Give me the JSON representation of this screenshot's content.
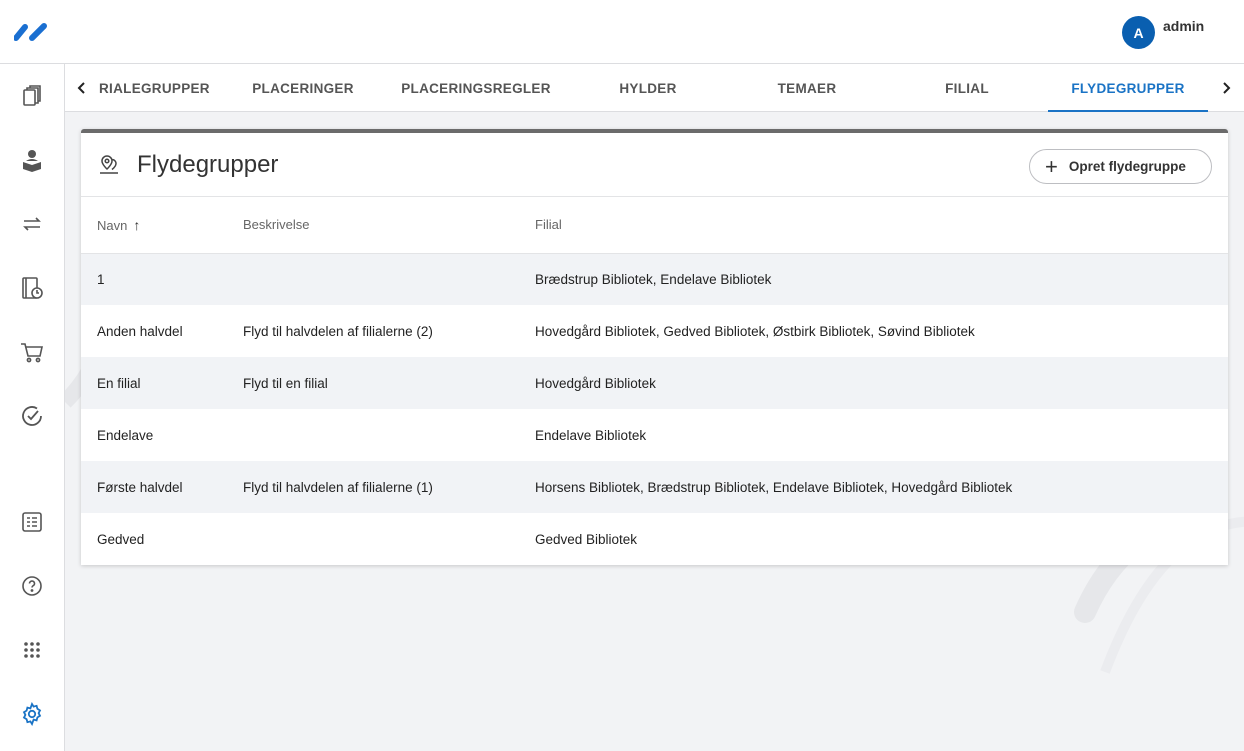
{
  "user": {
    "initial": "A",
    "name": "admin"
  },
  "tabs": [
    {
      "label": "RIALEGRUPPER",
      "active": false
    },
    {
      "label": "PLACERINGER",
      "active": false
    },
    {
      "label": "PLACERINGSREGLER",
      "active": false
    },
    {
      "label": "HYLDER",
      "active": false
    },
    {
      "label": "TEMAER",
      "active": false
    },
    {
      "label": "FILIAL",
      "active": false
    },
    {
      "label": "FLYDEGRUPPER",
      "active": true
    }
  ],
  "sidebar": {
    "icons": [
      "books-icon",
      "reader-icon",
      "transfer-icon",
      "book-clock-icon",
      "cart-icon",
      "check-circle-icon",
      "report-icon",
      "help-icon",
      "apps-grid-icon",
      "gear-icon"
    ]
  },
  "card": {
    "title": "Flydegrupper",
    "create_label": "Opret flydegruppe",
    "columns": {
      "name": "Navn",
      "description": "Beskrivelse",
      "branch": "Filial"
    },
    "rows": [
      {
        "name": "1",
        "description": "",
        "branch": "Brædstrup Bibliotek, Endelave Bibliotek"
      },
      {
        "name": "Anden halvdel",
        "description": "Flyd til halvdelen af filialerne (2)",
        "branch": "Hovedgård Bibliotek, Gedved Bibliotek, Østbirk Bibliotek, Søvind Bibliotek"
      },
      {
        "name": "En filial",
        "description": "Flyd til en filial",
        "branch": "Hovedgård Bibliotek"
      },
      {
        "name": "Endelave",
        "description": "",
        "branch": "Endelave Bibliotek"
      },
      {
        "name": "Første halvdel",
        "description": "Flyd til halvdelen af filialerne (1)",
        "branch": "Horsens Bibliotek, Brædstrup Bibliotek, Endelave Bibliotek, Hovedgård Bibliotek"
      },
      {
        "name": "Gedved",
        "description": "",
        "branch": "Gedved Bibliotek"
      }
    ]
  },
  "colors": {
    "accent": "#1a73c5",
    "avatar": "#0a5fb0",
    "row_alt": "#f1f3f6"
  }
}
